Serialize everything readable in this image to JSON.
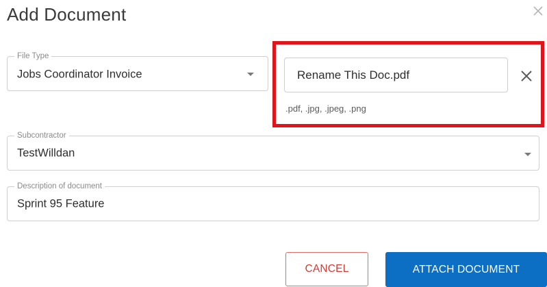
{
  "dialog": {
    "title": "Add Document",
    "close_icon": "close-icon"
  },
  "file_type": {
    "label": "File Type",
    "value": "Jobs Coordinator Invoice",
    "icon": "chevron-down-icon"
  },
  "file": {
    "name": "Rename This Doc.pdf",
    "remove_icon": "close-icon",
    "accepted_hint": ".pdf, .jpg, .jpeg, .png",
    "highlight_color": "#e0141b"
  },
  "subcontractor": {
    "label": "Subcontractor",
    "value": "TestWilldan",
    "icon": "chevron-down-icon"
  },
  "description": {
    "label": "Description of document",
    "value": "Sprint 95 Feature"
  },
  "actions": {
    "cancel_label": "CANCEL",
    "attach_label": "ATTACH DOCUMENT",
    "cancel_color": "#d23b34",
    "attach_color": "#0d6fc4"
  }
}
